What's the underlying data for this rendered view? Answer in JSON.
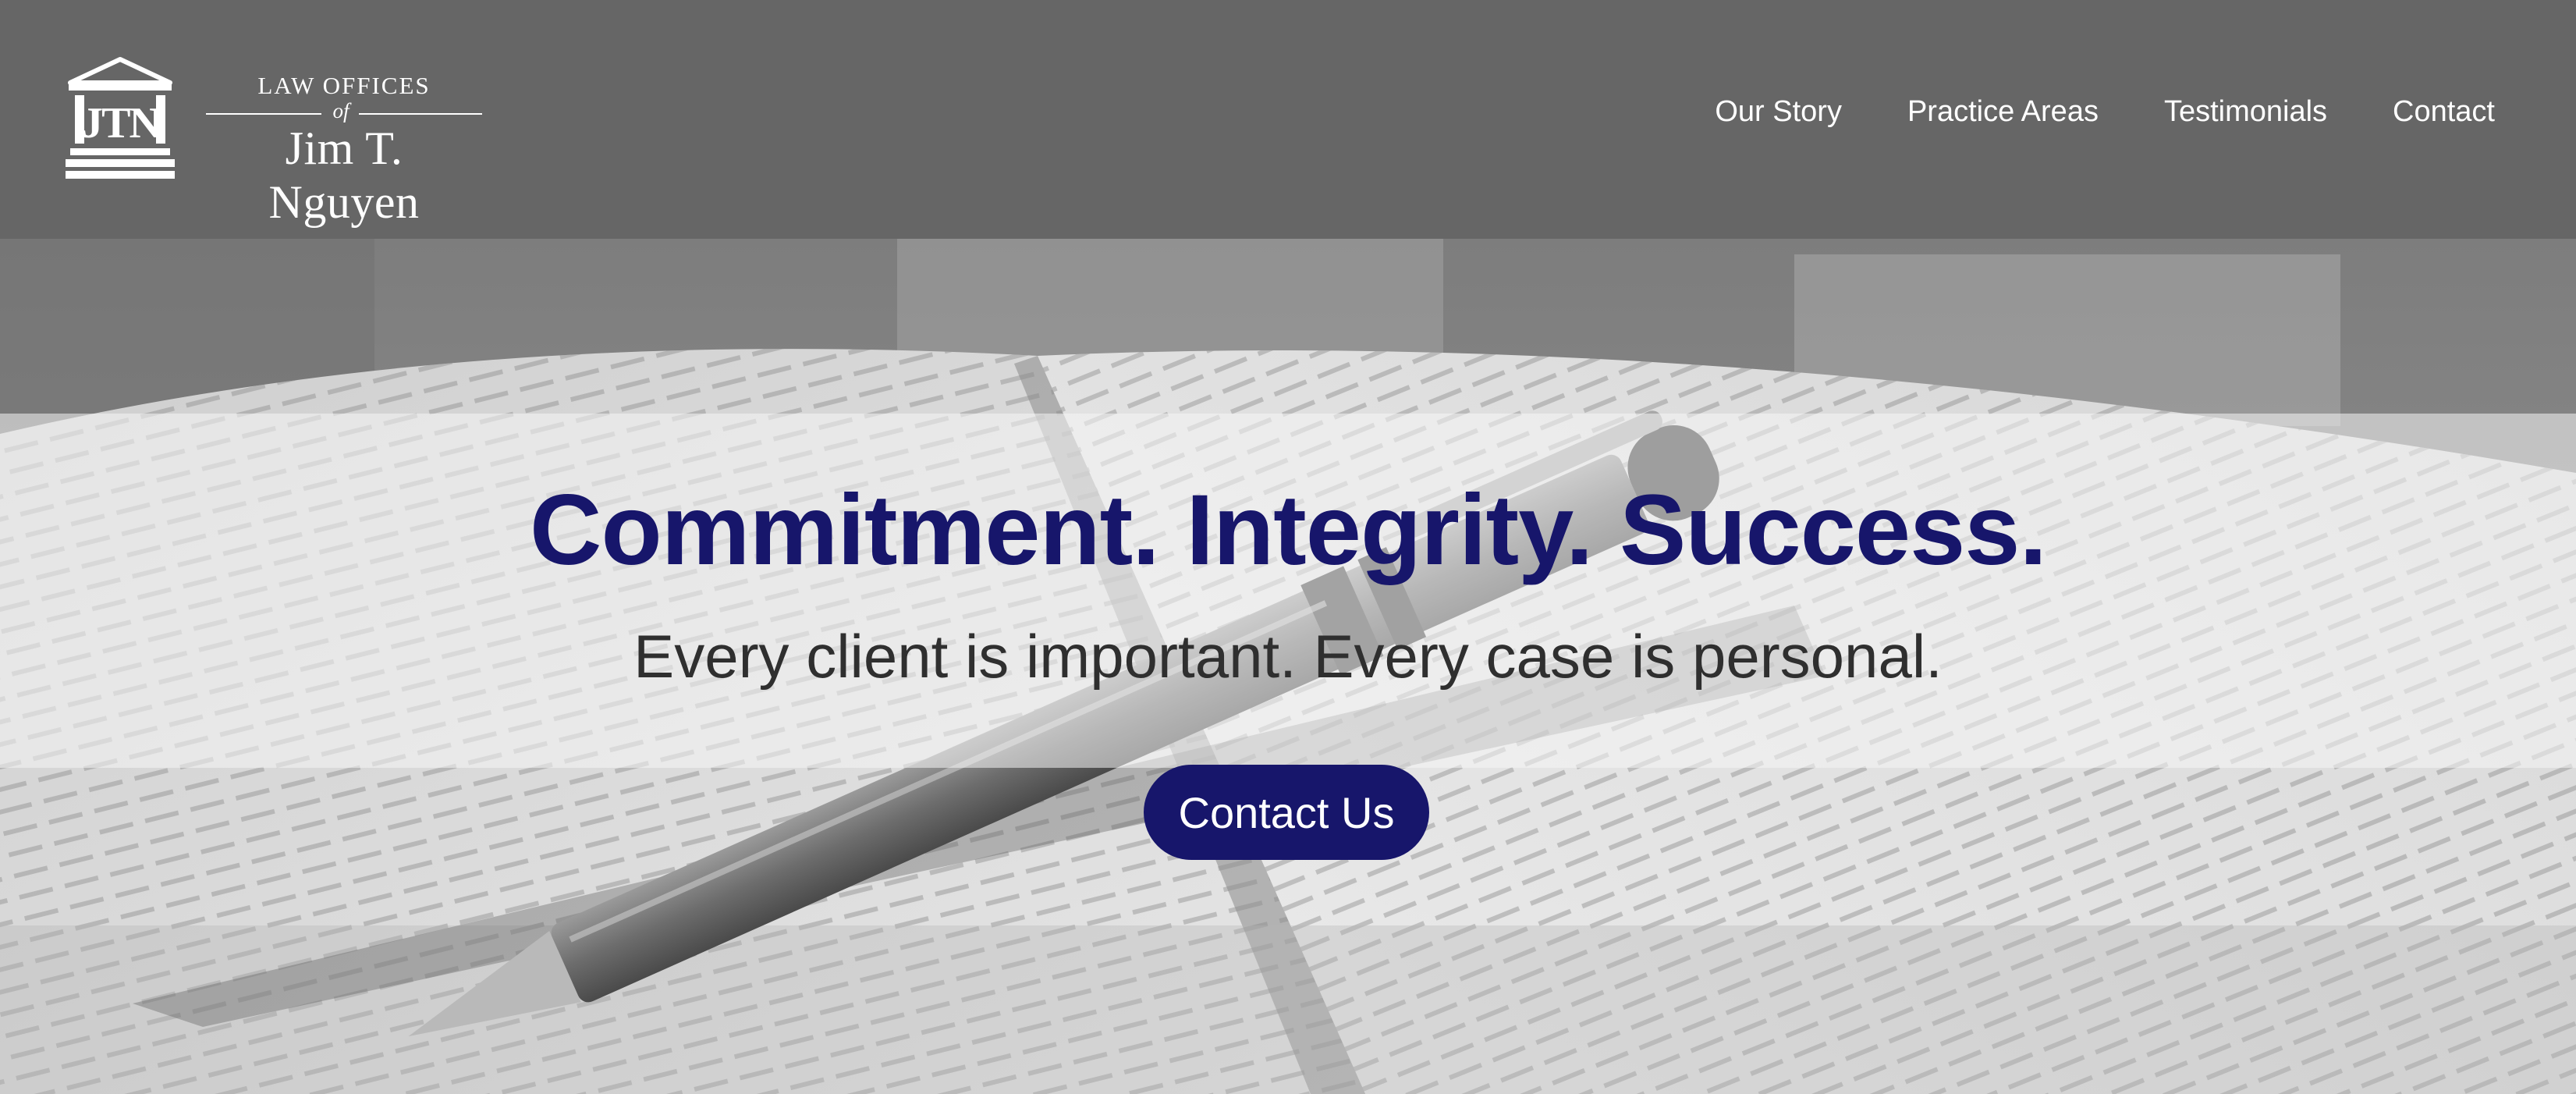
{
  "brand": {
    "monogram": "JTN",
    "line1": "LAW OFFICES",
    "line2": "of",
    "line3": "Jim T. Nguyen"
  },
  "nav": {
    "items": [
      {
        "label": "Our Story"
      },
      {
        "label": "Practice Areas"
      },
      {
        "label": "Testimonials"
      },
      {
        "label": "Contact"
      }
    ]
  },
  "hero": {
    "headline": "Commitment. Integrity. Success.",
    "subheadline": "Every client is important. Every case is personal.",
    "cta_label": "Contact Us",
    "background_description_icon": "open-book-with-pen-image"
  },
  "colors": {
    "header_bg": "#666666",
    "accent": "#17166b",
    "nav_text": "#ffffff",
    "subtext": "#2f2f2f"
  }
}
